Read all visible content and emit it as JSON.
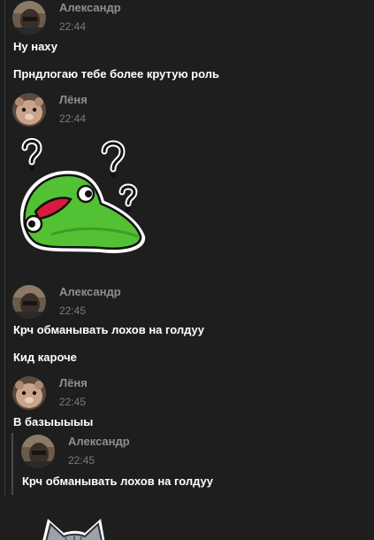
{
  "messages": [
    {
      "author": "Александр",
      "time": "22:44",
      "avatar_icon": "dark-avatar",
      "texts": [
        "Ну наху",
        "Прндлогаю тебе более крутую роль"
      ]
    },
    {
      "author": "Лёня",
      "time": "22:44",
      "avatar_icon": "hamster-avatar",
      "sticker_icon": "green-frog-question-sticker"
    },
    {
      "author": "Александр",
      "time": "22:45",
      "avatar_icon": "dark-avatar",
      "texts": [
        "Крч обманывать лохов на голдуу",
        "Кид кароче"
      ]
    },
    {
      "author": "Лёня",
      "time": "22:45",
      "avatar_icon": "hamster-avatar",
      "texts": [
        "В базыыыыы"
      ]
    }
  ],
  "reply": {
    "author": "Александр",
    "time": "22:45",
    "avatar_icon": "dark-avatar",
    "text": "Крч обманывать лохов на голдуу"
  },
  "bottom_sticker_icon": "gray-cat-sticker",
  "colors": {
    "background": "#1e1e1e",
    "author": "#8f8f8f",
    "time": "#7a7a7a",
    "text": "#ffffff",
    "sticker_green": "#52c234"
  }
}
